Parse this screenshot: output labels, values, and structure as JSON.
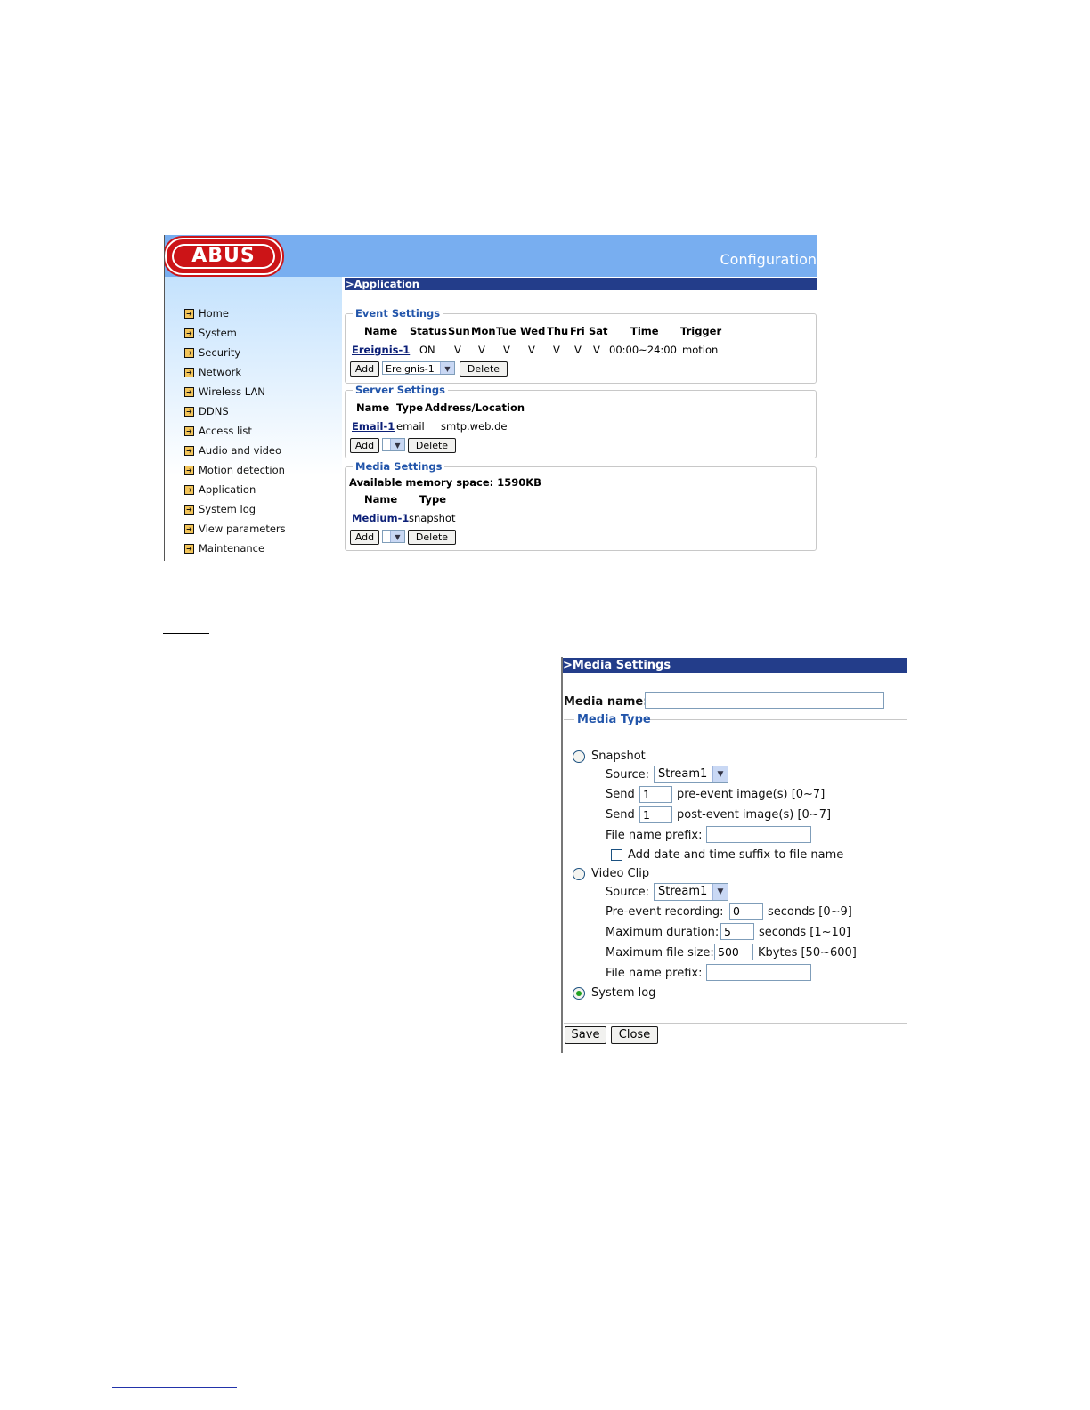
{
  "app": {
    "logo_text": "ABUS",
    "header_title": "Configuration",
    "page_title": ">Application",
    "nav": [
      "Home",
      "System",
      "Security",
      "Network",
      "Wireless LAN",
      "DDNS",
      "Access list",
      "Audio and video",
      "Motion detection",
      "Application",
      "System log",
      "View parameters",
      "Maintenance"
    ],
    "event_settings": {
      "legend": "Event Settings",
      "columns": [
        "Name",
        "Status",
        "Sun",
        "Mon",
        "Tue",
        "Wed",
        "Thu",
        "Fri",
        "Sat",
        "Time",
        "Trigger"
      ],
      "row": {
        "name": "Ereignis-1",
        "status": "ON",
        "days": [
          "V",
          "V",
          "V",
          "V",
          "V",
          "V",
          "V"
        ],
        "time": "00:00~24:00",
        "trigger": "motion"
      },
      "add_label": "Add",
      "select_value": "Ereignis-1",
      "delete_label": "Delete"
    },
    "server_settings": {
      "legend": "Server Settings",
      "columns": [
        "Name",
        "Type",
        "Address/Location"
      ],
      "row": {
        "name": "Email-1",
        "type": "email",
        "address": "smtp.web.de"
      },
      "add_label": "Add",
      "delete_label": "Delete"
    },
    "media_settings": {
      "legend": "Media Settings",
      "memory": "Available memory space: 1590KB",
      "columns": [
        "Name",
        "Type"
      ],
      "row": {
        "name": "Medium-1",
        "type": "snapshot"
      },
      "add_label": "Add",
      "delete_label": "Delete"
    }
  },
  "dialog": {
    "title": ">Media Settings",
    "media_name_label": "Media name:",
    "media_name_value": "",
    "media_type_legend": "Media Type",
    "snapshot": {
      "label": "Snapshot",
      "source_label": "Source:",
      "source_value": "Stream1",
      "send_label": "Send",
      "pre_value": "1",
      "pre_label": "pre-event image(s) [0~7]",
      "post_value": "1",
      "post_label": "post-event image(s) [0~7]",
      "prefix_label": "File name prefix:",
      "prefix_value": "",
      "suffix_label": "Add date and time suffix to file name"
    },
    "video_clip": {
      "label": "Video Clip",
      "source_label": "Source:",
      "source_value": "Stream1",
      "pre_label": "Pre-event recording:",
      "pre_value": "0",
      "pre_unit": "seconds [0~9]",
      "max_dur_label": "Maximum duration:",
      "max_dur_value": "5",
      "max_dur_unit": "seconds [1~10]",
      "max_size_label": "Maximum file size:",
      "max_size_value": "500",
      "max_size_unit": "Kbytes [50~600]",
      "prefix_label": "File name prefix:",
      "prefix_value": ""
    },
    "system_log": {
      "label": "System log"
    },
    "save_label": "Save",
    "close_label": "Close"
  }
}
